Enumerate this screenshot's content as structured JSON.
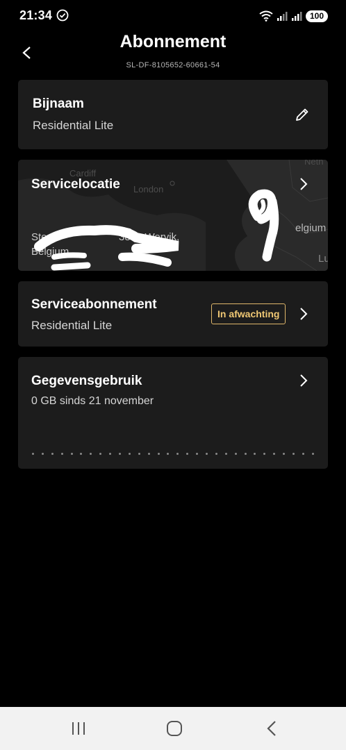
{
  "status_bar": {
    "time": "21:34",
    "battery": "100"
  },
  "header": {
    "title": "Abonnement",
    "subtitle": "SL-DF-8105652-60661-54"
  },
  "nickname_card": {
    "title": "Bijnaam",
    "value": "Residential Lite"
  },
  "location_card": {
    "title": "Servicelocatie",
    "map_labels": {
      "cardiff": "Cardiff",
      "london": "London",
      "netherlands_partial": "Neth",
      "belgium_partial": "elgium",
      "lux_partial": "Lu"
    },
    "address_visible_line1": "Ste",
    "address_visible_line1_end": "3840 Wervik,",
    "address_visible_line2": "Belgium"
  },
  "service_card": {
    "title": "Serviceabonnement",
    "value": "Residential Lite",
    "badge": "In afwachting"
  },
  "usage_card": {
    "title": "Gegevensgebruik",
    "value": "0 GB sinds 21 november"
  },
  "colors": {
    "card_bg": "#1c1c1c",
    "badge": "#f0c874",
    "accent_white": "#ffffff"
  }
}
